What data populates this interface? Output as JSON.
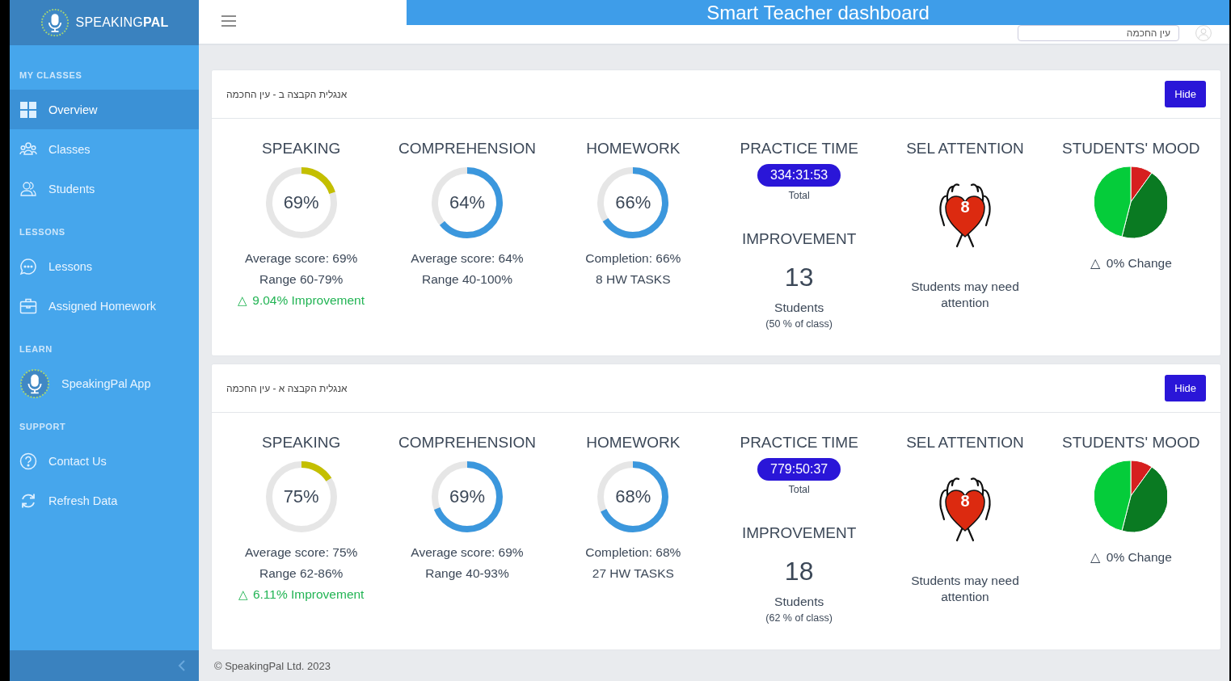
{
  "banner": {
    "title": "Smart Teacher dashboard"
  },
  "sidebar": {
    "logo": "SPEAKING**PAL**",
    "sections": [
      {
        "heading": "MY CLASSES",
        "items": [
          {
            "label": "Overview",
            "kind": "grid",
            "selected": true
          },
          {
            "label": "Classes",
            "kind": "group",
            "selected": false
          },
          {
            "label": "Students",
            "kind": "users",
            "selected": false
          }
        ]
      },
      {
        "heading": "LESSONS",
        "items": [
          {
            "label": "Lessons",
            "kind": "chat",
            "selected": false
          },
          {
            "label": "Assigned Homework",
            "kind": "briefcase",
            "selected": false
          }
        ]
      },
      {
        "heading": "LEARN",
        "items": [
          {
            "label": "SpeakingPal App",
            "kind": "app",
            "selected": false
          }
        ]
      },
      {
        "heading": "SUPPORT",
        "items": [
          {
            "label": "Contact Us",
            "kind": "help",
            "selected": false
          },
          {
            "label": "Refresh Data",
            "kind": "refresh",
            "selected": false
          }
        ]
      }
    ]
  },
  "header": {
    "class_select": "עין החכמה"
  },
  "classes": [
    {
      "title": "אנגלית הקבצה ב - עין החכמה",
      "hide_button": "Hide",
      "gauges": [
        {
          "title": "SPEAKING",
          "value": "69%",
          "level": 0.2,
          "color": "#c4bf00",
          "lines": [
            "Average score: 69%",
            "Range 60-79%"
          ],
          "trend": {
            "symbol": "△",
            "text": "9.04% Improvement"
          }
        },
        {
          "title": "COMPREHENSION",
          "value": "64%",
          "level": 0.64,
          "color": "#3b97dd",
          "lines": [
            "Average score: 64%",
            "Range 40-100%"
          ]
        },
        {
          "title": "HOMEWORK",
          "value": "66%",
          "level": 0.66,
          "color": "#3b97dd",
          "lines": [
            "Completion: 66%",
            "8 HW TASKS"
          ]
        }
      ],
      "practice": {
        "title": "PRACTICE TIME",
        "time": "334:31:53",
        "caption": "Total",
        "improvement_title": "IMPROVEMENT",
        "improvement_count": "13",
        "unit": "Students",
        "share": "(50 % of class)"
      },
      "sel": {
        "title": "SEL ATTENTION",
        "count": "8",
        "caption": "Students may need attention"
      },
      "mood": {
        "title": "STUDENTS' MOOD",
        "symbol": "△",
        "change": "0% Change"
      }
    },
    {
      "title": "אנגלית הקבצה א - עין החכמה",
      "hide_button": "Hide",
      "gauges": [
        {
          "title": "SPEAKING",
          "value": "75%",
          "level": 0.16,
          "color": "#c4bf00",
          "lines": [
            "Average score: 75%",
            "Range 62-86%"
          ],
          "trend": {
            "symbol": "△",
            "text": "6.11% Improvement"
          }
        },
        {
          "title": "COMPREHENSION",
          "value": "69%",
          "level": 0.69,
          "color": "#3b97dd",
          "lines": [
            "Average score: 69%",
            "Range 40-93%"
          ]
        },
        {
          "title": "HOMEWORK",
          "value": "68%",
          "level": 0.68,
          "color": "#3b97dd",
          "lines": [
            "Completion: 68%",
            "27 HW TASKS"
          ]
        }
      ],
      "practice": {
        "title": "PRACTICE TIME",
        "time": "779:50:37",
        "caption": "Total",
        "improvement_title": "IMPROVEMENT",
        "improvement_count": "18",
        "unit": "Students",
        "share": "(62 % of class)"
      },
      "sel": {
        "title": "SEL ATTENTION",
        "count": "8",
        "caption": "Students may need attention"
      },
      "mood": {
        "title": "STUDENTS' MOOD",
        "symbol": "△",
        "change": "0% Change"
      }
    }
  ],
  "footer": {
    "copyright": "© SpeakingPal Ltd. 2023"
  }
}
